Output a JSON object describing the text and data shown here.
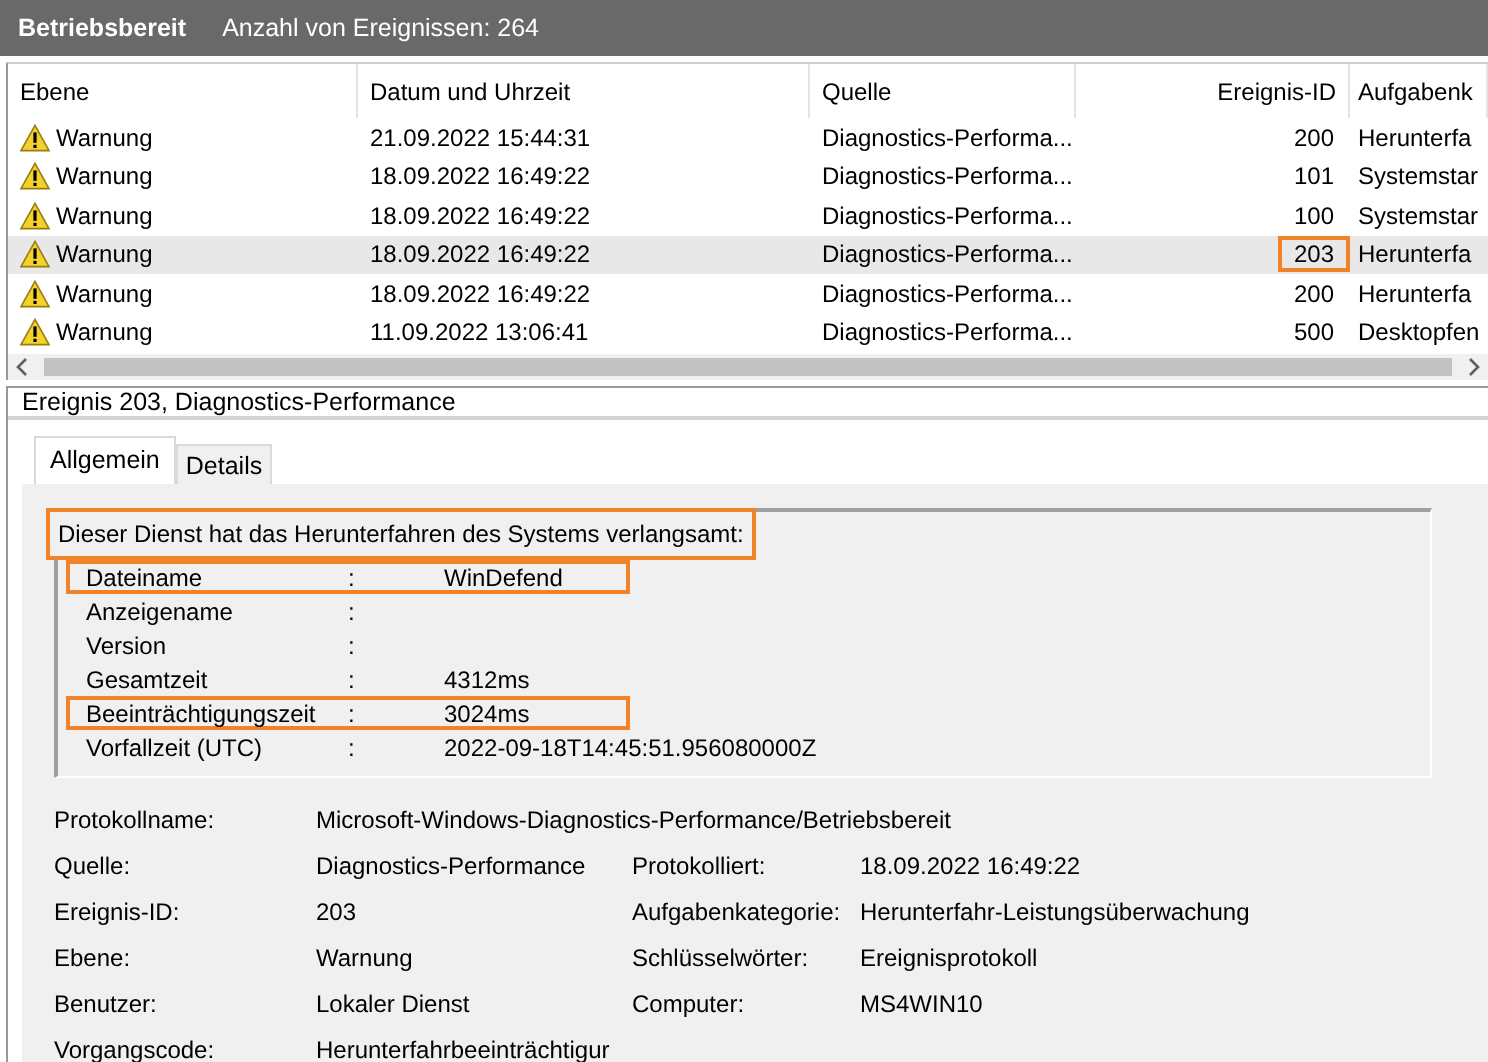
{
  "title_bar": {
    "log": "Betriebsbereit",
    "count": "Anzahl von Ereignissen: 264"
  },
  "table": {
    "columns": [
      "Ebene",
      "Datum und Uhrzeit",
      "Quelle",
      "Ereignis-ID",
      "Aufgabenk"
    ],
    "rows": [
      {
        "level": "Warnung",
        "date": "21.09.2022 15:44:31",
        "source": "Diagnostics-Performa...",
        "id": "200",
        "category": "Herunterfa",
        "selected": false,
        "id_highlighted": false
      },
      {
        "level": "Warnung",
        "date": "18.09.2022 16:49:22",
        "source": "Diagnostics-Performa...",
        "id": "101",
        "category": "Systemstar",
        "selected": false,
        "id_highlighted": false
      },
      {
        "level": "Warnung",
        "date": "18.09.2022 16:49:22",
        "source": "Diagnostics-Performa...",
        "id": "100",
        "category": "Systemstar",
        "selected": false,
        "id_highlighted": false
      },
      {
        "level": "Warnung",
        "date": "18.09.2022 16:49:22",
        "source": "Diagnostics-Performa...",
        "id": "203",
        "category": "Herunterfa",
        "selected": true,
        "id_highlighted": true
      },
      {
        "level": "Warnung",
        "date": "18.09.2022 16:49:22",
        "source": "Diagnostics-Performa...",
        "id": "200",
        "category": "Herunterfa",
        "selected": false,
        "id_highlighted": false
      },
      {
        "level": "Warnung",
        "date": "11.09.2022 13:06:41",
        "source": "Diagnostics-Performa...",
        "id": "500",
        "category": "Desktopfen",
        "selected": false,
        "id_highlighted": false
      }
    ]
  },
  "detail": {
    "header": "Ereignis 203, Diagnostics-Performance",
    "tabs": [
      {
        "label": "Allgemein",
        "selected": true
      },
      {
        "label": "Details",
        "selected": false
      }
    ],
    "message": {
      "text": "Dieser Dienst hat das Herunterfahren des Systems verlangsamt:",
      "highlighted": true,
      "rows": [
        {
          "label": "Dateiname",
          "colon": ":",
          "value": "WinDefend",
          "highlighted": true
        },
        {
          "label": "Anzeigename",
          "colon": ":",
          "highlighted": false
        },
        {
          "label": "Version",
          "colon": ":",
          "highlighted": false
        },
        {
          "label": "Gesamtzeit",
          "colon": ":",
          "value": "4312ms",
          "highlighted": false
        },
        {
          "label": "Beeinträchtigungszeit",
          "colon": ":",
          "value": "3024ms",
          "highlighted": true
        },
        {
          "label": "Vorfallzeit (UTC)",
          "colon": ":",
          "value": "2022-09-18T14:45:51.956080000Z",
          "highlighted": false
        }
      ]
    },
    "fields": [
      {
        "label": "Protokollname:",
        "value": "Microsoft-Windows-Diagnostics-Performance/Betriebsbereit"
      },
      {
        "label": "Quelle:",
        "value": "Diagnostics-Performance",
        "label2": "Protokolliert:",
        "value2": "18.09.2022 16:49:22"
      },
      {
        "label": "Ereignis-ID:",
        "value": "203",
        "label2": "Aufgabenkategorie:",
        "value2": "Herunterfahr-Leistungsüberwachung"
      },
      {
        "label": "Ebene:",
        "value": "Warnung",
        "label2": "Schlüsselwörter:",
        "value2": "Ereignisprotokoll"
      },
      {
        "label": "Benutzer:",
        "value": "Lokaler Dienst",
        "label2": "Computer:",
        "value2": "MS4WIN10"
      },
      {
        "label": "Vorgangscode:",
        "value": "Herunterfahrbeeinträchtigur"
      }
    ]
  }
}
